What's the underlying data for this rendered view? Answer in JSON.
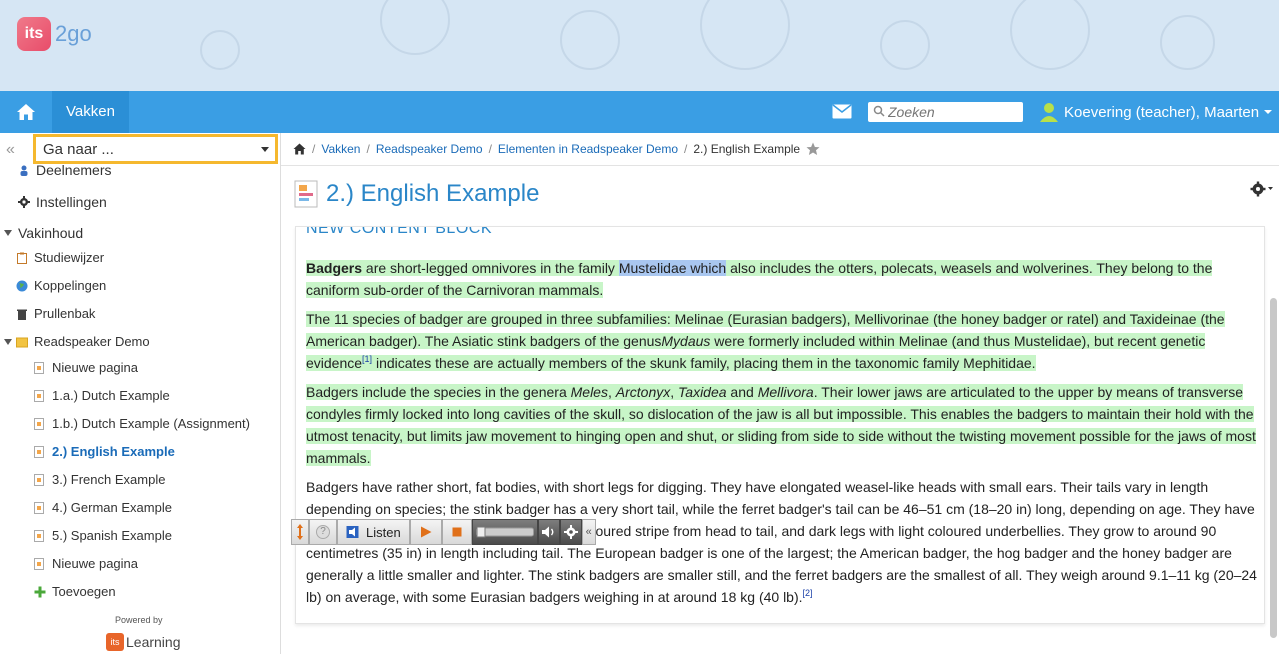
{
  "app": {
    "logo_text": "2go",
    "logo_box": "its"
  },
  "nav": {
    "tab_label": "Vakken",
    "search_placeholder": "Zoeken",
    "user_name": "Koevering (teacher), Maarten"
  },
  "sidebar": {
    "goto_label": "Ga naar ...",
    "items": [
      {
        "label": "Deelnemers",
        "icon": "person-icon"
      },
      {
        "label": "Instellingen",
        "icon": "gear-icon"
      },
      {
        "label": "Vakinhoud",
        "icon": "triangle-icon"
      },
      {
        "label": "Studiewijzer",
        "icon": "clipboard-icon"
      },
      {
        "label": "Koppelingen",
        "icon": "globe-icon"
      },
      {
        "label": "Prullenbak",
        "icon": "trash-icon"
      },
      {
        "label": "Readspeaker Demo",
        "icon": "folder-icon"
      },
      {
        "label": "Nieuwe pagina",
        "icon": "page-icon"
      },
      {
        "label": "1.a.) Dutch Example",
        "icon": "page-icon"
      },
      {
        "label": "1.b.) Dutch Example (Assignment)",
        "icon": "page-icon"
      },
      {
        "label": "2.) English Example",
        "icon": "page-icon"
      },
      {
        "label": "3.) French Example",
        "icon": "page-icon"
      },
      {
        "label": "4.) German Example",
        "icon": "page-icon"
      },
      {
        "label": "5.) Spanish Example",
        "icon": "page-icon"
      },
      {
        "label": "Nieuwe pagina",
        "icon": "page-icon"
      },
      {
        "label": "Toevoegen",
        "icon": "plus-icon"
      }
    ],
    "powered_by": "Powered by",
    "footer_logo_box": "its",
    "footer_logo_text": "Learning"
  },
  "breadcrumb": {
    "items": [
      "Vakken",
      "Readspeaker Demo",
      "Elementen in Readspeaker Demo"
    ],
    "current": "2.) English Example"
  },
  "page": {
    "title": "2.) English Example",
    "block_heading": "NEW CONTENT BLOCK"
  },
  "article": {
    "p1_bold": "Badgers",
    "p1_a": " are short-legged omnivores in the family ",
    "p1_sel": "Mustelidae which",
    "p1_b": " also includes the otters, polecats, weasels and wolverines. They belong to the caniform sub-order of the Carnivoran mammals.",
    "p2_a": "The 11 species of badger are grouped in three subfamilies: Melinae (Eurasian badgers), Mellivorinae (the honey badger or ratel) and Taxideinae (the American badger). The Asiatic stink badgers of the genus",
    "p2_it": "Mydaus",
    "p2_b": " were formerly included within Melinae (and thus Mustelidae), but recent genetic evidence",
    "p2_sup": "[1]",
    "p2_c": " indicates these are actually members of the skunk family, placing them in the taxonomic family Mephitidae.",
    "p3_a": "Badgers include the species in the genera ",
    "p3_it1": "Meles",
    "p3_c1": ", ",
    "p3_it2": "Arctonyx",
    "p3_c2": ", ",
    "p3_it3": "Taxidea",
    "p3_and": " and ",
    "p3_it4": "Mellivora",
    "p3_b": ". Their lower jaws are articulated to the upper by means of transverse condyles firmly locked into long cavities of the skull, so dislocation of the jaw is all but impossible. This enables the badgers to maintain their hold with the utmost tenacity, but limits jaw movement to hinging open and shut, or sliding from side to side without the twisting movement possible for the jaws of most mammals.",
    "p4_a": "Badgers have rather short, fat bodies, with short legs for digging. They have elongated weasel-like heads with small ears. Their tails vary in length depending on species; the stink badger has a very short tail, while the ferret badger's tail can be 46–51 cm (18–20 in) long, depending on age. They have black, white and grey fur bodies with a light-coloured stripe from head to tail, and dark legs with light coloured underbellies. They grow to around 90 centimetres (35 in) in length including tail. The European badger is one of the largest; the American badger, the hog badger and the honey badger are generally a little smaller and lighter. The stink badgers are smaller still, and the ferret badgers are the smallest of all. They weigh around 9.1–11 kg (20–24 lb) on average, with some Eurasian badgers weighing in at around 18 kg (40 lb).",
    "p4_sup": "[2]"
  },
  "readspeaker": {
    "listen_label": "Listen",
    "help_label": "?",
    "collapse_label": "«"
  }
}
